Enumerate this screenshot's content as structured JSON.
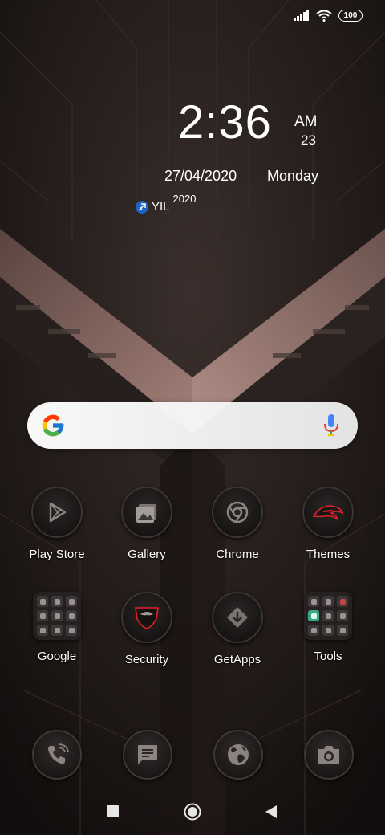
{
  "status_bar": {
    "battery": "100",
    "icons": [
      "signal-icon",
      "wifi-icon",
      "battery-icon"
    ]
  },
  "clock": {
    "time": "2:36",
    "ampm": "AM",
    "seconds": "23",
    "date": "27/04/2020",
    "day": "Monday",
    "horoscope_label": "YIL",
    "horoscope_year": "2020"
  },
  "search": {
    "icons": [
      "google-g-icon",
      "microphone-icon"
    ]
  },
  "apps": [
    {
      "label": "Play Store",
      "icon": "play-store-icon"
    },
    {
      "label": "Gallery",
      "icon": "gallery-icon"
    },
    {
      "label": "Chrome",
      "icon": "chrome-icon"
    },
    {
      "label": "Themes",
      "icon": "themes-icon"
    },
    {
      "label": "Google",
      "icon": "google-folder"
    },
    {
      "label": "Security",
      "icon": "security-icon"
    },
    {
      "label": "GetApps",
      "icon": "getapps-icon"
    },
    {
      "label": "Tools",
      "icon": "tools-folder"
    }
  ],
  "dock": [
    {
      "icon": "phone-icon"
    },
    {
      "icon": "messages-icon"
    },
    {
      "icon": "browser-icon"
    },
    {
      "icon": "camera-icon"
    }
  ],
  "navigation": {
    "icons": [
      "recents-button",
      "home-button",
      "back-button"
    ]
  },
  "colors": {
    "accent_red": "#e0202c",
    "wallpaper_dark": "#1c1513",
    "chevron": "#8f6f68"
  }
}
